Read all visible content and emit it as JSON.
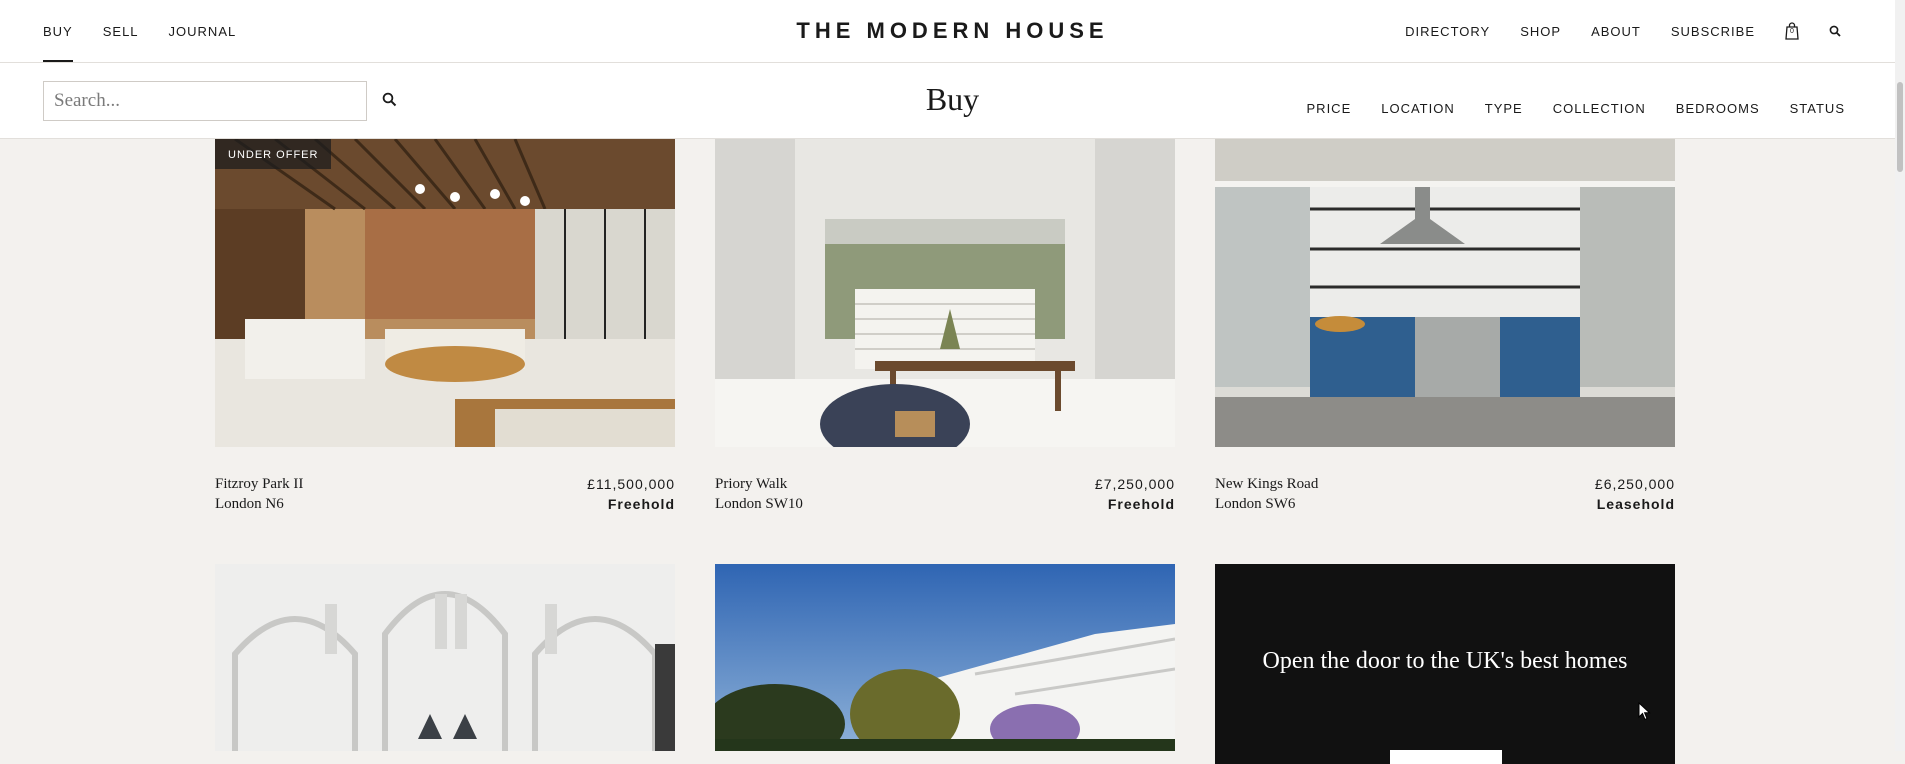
{
  "topnav": {
    "left": [
      "BUY",
      "SELL",
      "JOURNAL"
    ],
    "brand": "THE MODERN HOUSE",
    "right": [
      "DIRECTORY",
      "SHOP",
      "ABOUT",
      "SUBSCRIBE"
    ],
    "cart_count": "0"
  },
  "search": {
    "placeholder": "Search..."
  },
  "page_title": "Buy",
  "filters": [
    "PRICE",
    "LOCATION",
    "TYPE",
    "COLLECTION",
    "BEDROOMS",
    "STATUS"
  ],
  "listings": [
    {
      "name": "Fitzroy Park II",
      "area": "London N6",
      "price": "£11,500,000",
      "tenure": "Freehold",
      "badge": "UNDER OFFER"
    },
    {
      "name": "Priory Walk",
      "area": "London SW10",
      "price": "£7,250,000",
      "tenure": "Freehold"
    },
    {
      "name": "New Kings Road",
      "area": "London SW6",
      "price": "£6,250,000",
      "tenure": "Leasehold"
    }
  ],
  "promo": {
    "text": "Open the door to the UK's best homes"
  },
  "colors": {
    "page_bg": "#f3f1ee",
    "header_bg": "#ffffff",
    "promo_bg": "#111111",
    "text": "#1a1a1a"
  },
  "icons": [
    "shopping-bag-icon",
    "search-icon",
    "cursor-icon"
  ]
}
